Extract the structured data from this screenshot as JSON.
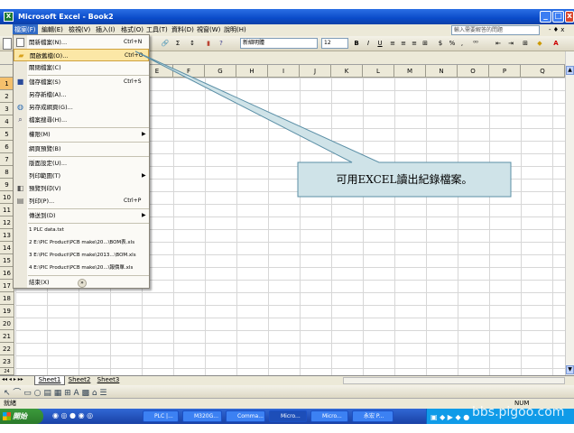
{
  "window": {
    "title": "Microsoft Excel - Book2",
    "minimize": "_",
    "maximize": "□",
    "close": "x"
  },
  "menubar": {
    "items": [
      "檔案(F)",
      "編輯(E)",
      "檢視(V)",
      "插入(I)",
      "格式(O)",
      "工具(T)",
      "資料(D)",
      "視窗(W)",
      "說明(H)"
    ],
    "help_placeholder": "輸入需要解答的問題",
    "right_controls": "- ♦ x"
  },
  "toolbar": {
    "font_name": "新細明體",
    "font_size": "12",
    "bold": "B",
    "italic": "I",
    "underline": "U",
    "currency": "$",
    "percent": "%",
    "comma": ","
  },
  "grid": {
    "columns": [
      "F",
      "G",
      "H",
      "I",
      "J",
      "K",
      "L",
      "M",
      "N",
      "O",
      "P",
      "Q"
    ],
    "rows": [
      "1",
      "2",
      "3",
      "4",
      "5",
      "6",
      "7",
      "8",
      "9",
      "10",
      "11",
      "12",
      "13",
      "14",
      "15",
      "16",
      "17",
      "18",
      "19",
      "20",
      "21",
      "22",
      "23",
      "24"
    ],
    "column_e": "E"
  },
  "file_menu": {
    "items": [
      {
        "label": "開新檔案(N)...",
        "shortcut": "Ctrl+N",
        "icon": "new-file-icon"
      },
      {
        "label": "開啟舊檔(O)...",
        "shortcut": "Ctrl+O",
        "icon": "open-folder-icon",
        "highlighted": true
      },
      {
        "label": "關閉檔案(C)",
        "shortcut": ""
      },
      {
        "label": "儲存檔案(S)",
        "shortcut": "Ctrl+S",
        "icon": "save-icon"
      },
      {
        "label": "另存新檔(A)...",
        "shortcut": ""
      },
      {
        "label": "另存成網頁(G)...",
        "shortcut": "",
        "icon": "web-save-icon"
      },
      {
        "label": "檔案搜尋(H)...",
        "shortcut": "",
        "icon": "search-file-icon"
      },
      {
        "label": "權限(M)",
        "shortcut": "",
        "submenu": true
      },
      {
        "label": "網頁預覽(B)",
        "shortcut": ""
      },
      {
        "label": "版面設定(U)...",
        "shortcut": ""
      },
      {
        "label": "列印範圍(T)",
        "shortcut": "",
        "submenu": true
      },
      {
        "label": "預覽列印(V)",
        "shortcut": "",
        "icon": "print-preview-icon"
      },
      {
        "label": "列印(P)...",
        "shortcut": "Ctrl+P",
        "icon": "print-icon"
      },
      {
        "label": "傳送到(D)",
        "shortcut": "",
        "submenu": true
      },
      {
        "label": "1 PLC data.txt",
        "shortcut": ""
      },
      {
        "label": "2 E:\\PIC Product\\PCB make\\20...\\BOM表.xls",
        "shortcut": ""
      },
      {
        "label": "3 E:\\PIC Product\\PCB make\\2013...\\BOM.xls",
        "shortcut": ""
      },
      {
        "label": "4 E:\\PIC Product\\PCB make\\20...\\報價單.xls",
        "shortcut": ""
      },
      {
        "label": "結束(X)",
        "shortcut": ""
      }
    ],
    "expand": "»"
  },
  "callout": {
    "text": "可用EXCEL讀出紀錄檔案。"
  },
  "sheets": {
    "tabs": [
      "Sheet1",
      "Sheet2",
      "Sheet3"
    ]
  },
  "statusbar": {
    "left": "就緒",
    "num": "NUM"
  },
  "taskbar": {
    "start": "開始",
    "items": [
      "PLC |...",
      "M320G...",
      "Comma...",
      "Micro...",
      "Micro...",
      "永宏 P..."
    ],
    "watermark": "bbs.pigoo.com"
  },
  "colors": {
    "titlebar": "#0a4bc9",
    "menu_highlight": "#fbe7a6",
    "callout_fill": "#cfe3e8",
    "callout_stroke": "#5b8fa6"
  }
}
